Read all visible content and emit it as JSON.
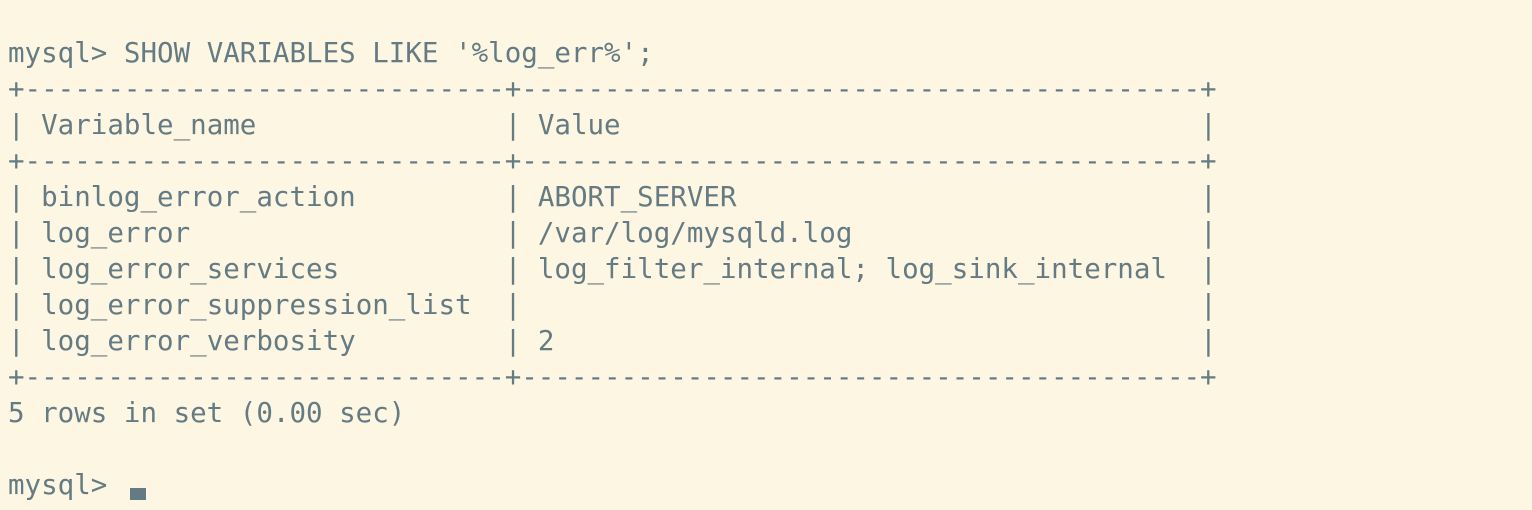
{
  "terminal": {
    "prompt": "mysql>",
    "command": "SHOW VARIABLES LIKE '%log_err%';",
    "border": "+-----------------------------+-----------------------------------------+",
    "header": {
      "col1": "Variable_name",
      "col2": "Value"
    },
    "rows": [
      {
        "name": "binlog_error_action",
        "value": "ABORT_SERVER"
      },
      {
        "name": "log_error",
        "value": "/var/log/mysqld.log"
      },
      {
        "name": "log_error_services",
        "value": "log_filter_internal; log_sink_internal"
      },
      {
        "name": "log_error_suppression_list",
        "value": ""
      },
      {
        "name": "log_error_verbosity",
        "value": "2"
      }
    ],
    "summary": "5 rows in set (0.00 sec)",
    "final_prompt": "mysql>"
  },
  "colors": {
    "background": "#fdf6e3",
    "text": "#657b83"
  }
}
